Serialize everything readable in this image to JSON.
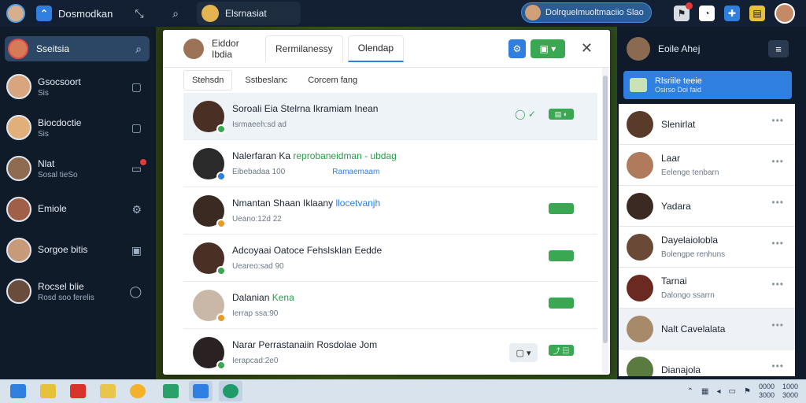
{
  "topbar": {
    "app_title": "Dosmodkan",
    "chat_label": "Elsrnasiat",
    "pill_label": "Dolrquelmuoltmaciio Slao",
    "icons": [
      "collapse-icon",
      "search-icon"
    ]
  },
  "sidebar": {
    "search_label": "Sseitsia",
    "items": [
      {
        "name": "Gsocsoort",
        "sub": "Sis",
        "color": "#d9a57e"
      },
      {
        "name": "Biocdoctie",
        "sub": "Sis",
        "color": "#e1b07a"
      },
      {
        "name": "Nlat",
        "sub": "Sosal tieSo",
        "color": "#8d6a50"
      },
      {
        "name": "Emiole",
        "sub": "",
        "color": "#a06048"
      },
      {
        "name": "Sorgoe bitis",
        "sub": "",
        "color": "#c79a79"
      },
      {
        "name": "Rocsel blie",
        "sub": "Rosd soo ferelis",
        "color": "#6a4c3c"
      }
    ]
  },
  "dialog": {
    "header_name": "Eiddor Ibdia",
    "tabs": [
      "Rermilanessy",
      "Olendap"
    ],
    "subtabs": [
      "Stehsdn",
      "Sstbeslanc",
      "Corcem fang"
    ],
    "rows": [
      {
        "title": "Soroali Eia Stelrna Ikramiam Inean",
        "meta": "Isrmaeeh:sd ad",
        "extra": "",
        "tag": "",
        "color": "#4a3024"
      },
      {
        "title": "Nalerfaran Ka",
        "title_hl": "reprobaneidman - ubdag",
        "meta": "Eibebadaa 100",
        "extra": "Ramaemaam",
        "tag": "",
        "color": "#2a2a2a"
      },
      {
        "title": "Nmantan Shaan Iklaany",
        "title_hl": "llocetvanjh",
        "meta": "Ueano:12d 22",
        "extra": "",
        "tag": "",
        "color": "#3a2a22"
      },
      {
        "title": "Adcoyaai Oatoce Fehslsklan",
        "title_hl": "Eedde",
        "meta": "Ueareo:sad 90",
        "extra": "",
        "tag": "",
        "color": "#4a3024"
      },
      {
        "title": "Dalanian",
        "title_hl": "Kena",
        "meta": "Ierrap ssa:90",
        "extra": "",
        "tag": "",
        "color": "#c9b8a8"
      },
      {
        "title": "Narar Perrastanaiin",
        "title_hl": "Rosdolae Jom",
        "meta": "Ierapcad:2e0",
        "extra": "",
        "tag": "",
        "color": "#2a2222"
      }
    ]
  },
  "rpanel": {
    "header_name": "Eoile Ahej",
    "banner_title": "Rlsriile teeie",
    "banner_sub": "Osirso Doi faid",
    "items": [
      {
        "name": "Slenirlat",
        "sub": "",
        "color": "#5a3a28"
      },
      {
        "name": "Laar",
        "sub": "Eelenge tenbarn",
        "color": "#b07a5c"
      },
      {
        "name": "Yadara",
        "sub": "",
        "color": "#3a2a22"
      },
      {
        "name": "Dayelaiolobla",
        "sub": "Bolengpe renhuns",
        "color": "#6a4a36"
      },
      {
        "name": "Tarnai",
        "sub": "Dalongo ssarrn",
        "color": "#6a2a22"
      },
      {
        "name": "Nalt Cavelalata",
        "sub": "",
        "color": "#a78a6a"
      },
      {
        "name": "Dianajola",
        "sub": "",
        "color": "#5a7a40"
      }
    ]
  },
  "taskbar": {
    "clock_time": "0000",
    "clock_date": "3000",
    "clock_time2": "1000",
    "clock_date2": "3000"
  }
}
